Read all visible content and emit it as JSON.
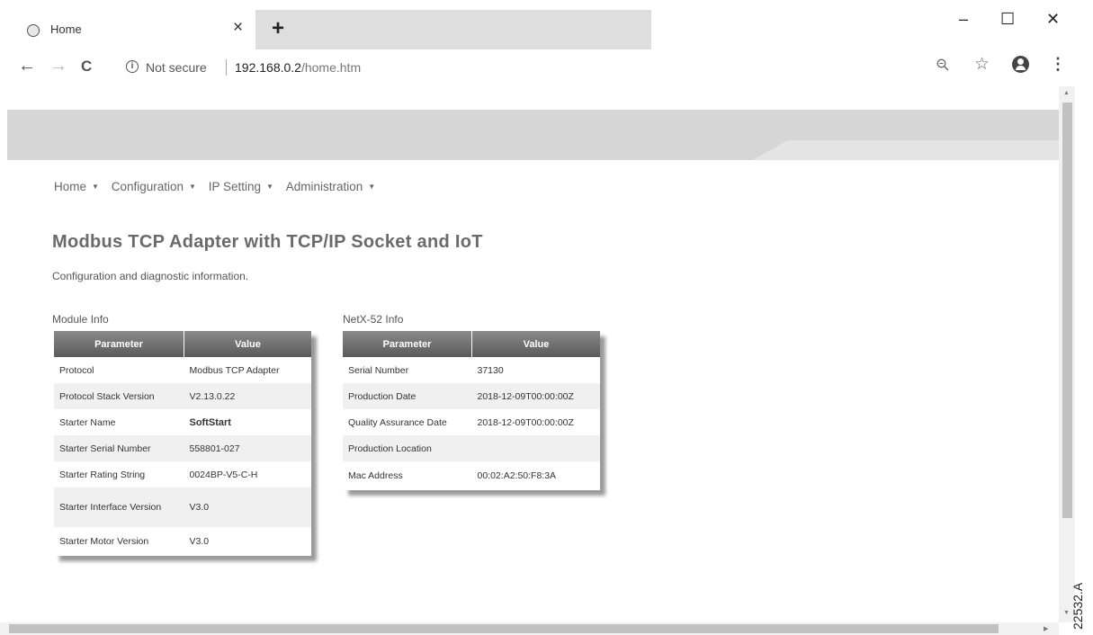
{
  "browser": {
    "tab_title": "Home",
    "tab_close": "×",
    "new_tab": "+",
    "window": {
      "minimize": "–",
      "maximize": "☐",
      "close": "✕"
    },
    "nav": {
      "back": "←",
      "forward": "→",
      "reload": "C"
    },
    "info_icon": "i",
    "security_text": "Not secure",
    "url_host": "192.168.0.2",
    "url_path": "/home.htm",
    "zoom_icon": "zoom-icon",
    "bookmark": "☆",
    "menu": "⋮"
  },
  "nav_menu": [
    {
      "label": "Home"
    },
    {
      "label": "Configuration"
    },
    {
      "label": "IP Setting"
    },
    {
      "label": "Administration"
    }
  ],
  "nav_caret": "▼",
  "page": {
    "title": "Modbus TCP Adapter with TCP/IP Socket and IoT",
    "subtitle": "Configuration and diagnostic information."
  },
  "module_info": {
    "title": "Module Info",
    "headers": [
      "Parameter",
      "Value"
    ],
    "rows": [
      {
        "param": "Protocol",
        "value": "Modbus TCP Adapter"
      },
      {
        "param": "Protocol Stack Version",
        "value": "V2.13.0.22"
      },
      {
        "param": "Starter Name",
        "value": "SoftStart"
      },
      {
        "param": "Starter Serial Number",
        "value": "558801-027"
      },
      {
        "param": "Starter Rating String",
        "value": "0024BP-V5-C-H"
      },
      {
        "param": "Starter Interface Version",
        "value": "V3.0"
      },
      {
        "param": "Starter Motor Version",
        "value": "V3.0"
      }
    ]
  },
  "netx_info": {
    "title": "NetX-52 Info",
    "headers": [
      "Parameter",
      "Value"
    ],
    "rows": [
      {
        "param": "Serial Number",
        "value": "37130"
      },
      {
        "param": "Production Date",
        "value": "2018-12-09T00:00:00Z"
      },
      {
        "param": "Quality Assurance Date",
        "value": "2018-12-09T00:00:00Z"
      },
      {
        "param": "Production Location",
        "value": ""
      },
      {
        "param": "Mac Address",
        "value": "00:02:A2:50:F8:3A"
      }
    ]
  },
  "figure_id": "22532.A"
}
